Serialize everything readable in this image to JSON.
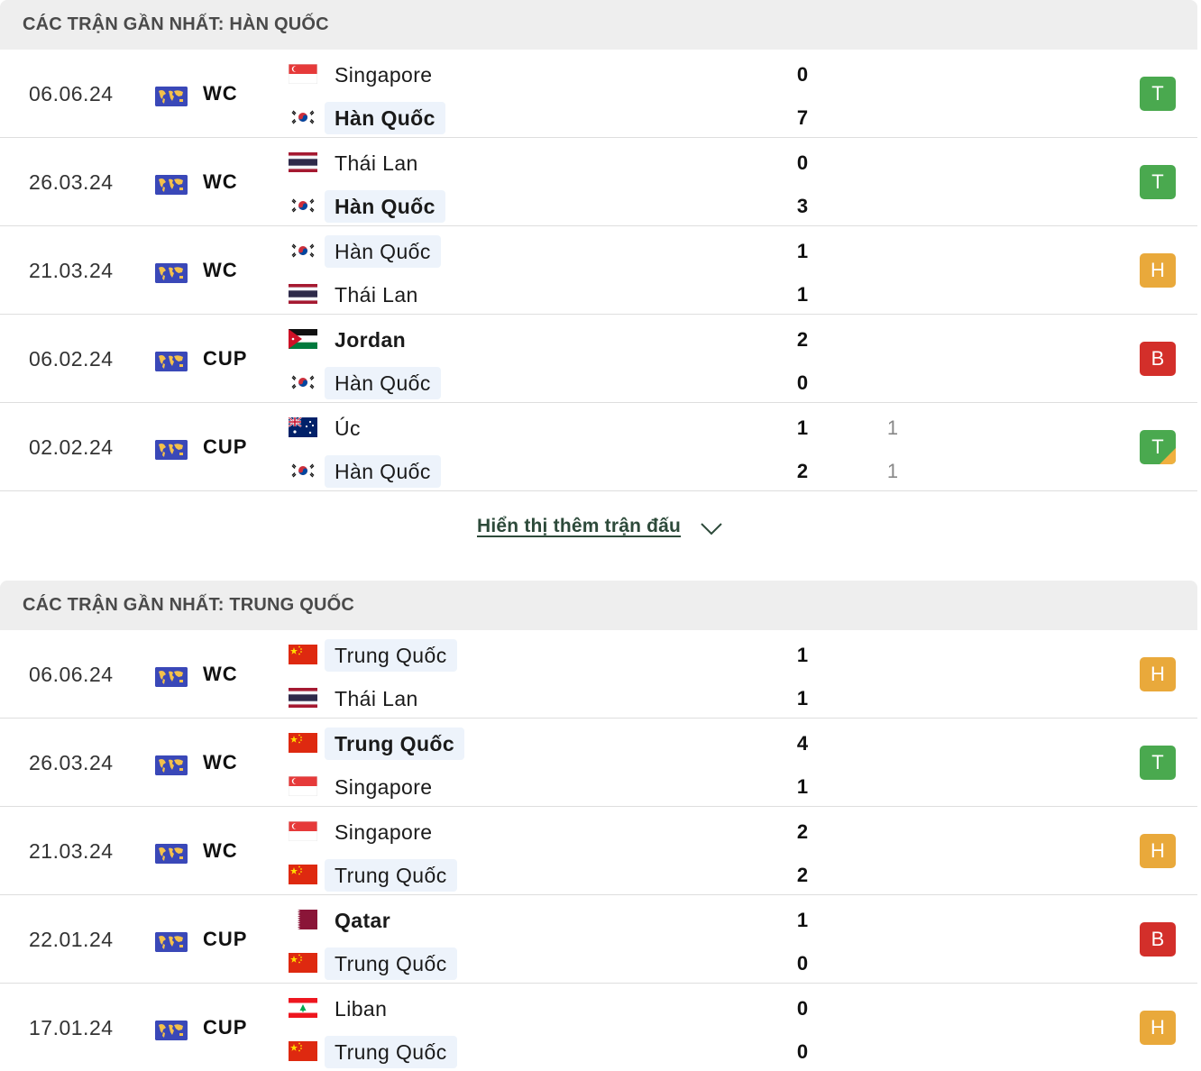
{
  "sections": [
    {
      "title": "CÁC TRẬN GẦN NHẤT: HÀN QUỐC",
      "matches": [
        {
          "date": "06.06.24",
          "comp": "WC",
          "home": {
            "name": "Singapore",
            "flag": "singapore-flag",
            "bold": false,
            "focus": false
          },
          "away": {
            "name": "Hàn Quốc",
            "flag": "korea-flag",
            "bold": true,
            "focus": true
          },
          "home_score": "0",
          "away_score": "7",
          "home_pen": "",
          "away_pen": "",
          "result": "T",
          "result_color": "#4aa94f"
        },
        {
          "date": "26.03.24",
          "comp": "WC",
          "home": {
            "name": "Thái Lan",
            "flag": "thailand-flag",
            "bold": false,
            "focus": false
          },
          "away": {
            "name": "Hàn Quốc",
            "flag": "korea-flag",
            "bold": true,
            "focus": true
          },
          "home_score": "0",
          "away_score": "3",
          "home_pen": "",
          "away_pen": "",
          "result": "T",
          "result_color": "#4aa94f"
        },
        {
          "date": "21.03.24",
          "comp": "WC",
          "home": {
            "name": "Hàn Quốc",
            "flag": "korea-flag",
            "bold": false,
            "focus": true
          },
          "away": {
            "name": "Thái Lan",
            "flag": "thailand-flag",
            "bold": false,
            "focus": false
          },
          "home_score": "1",
          "away_score": "1",
          "home_pen": "",
          "away_pen": "",
          "result": "H",
          "result_color": "#e9a93b"
        },
        {
          "date": "06.02.24",
          "comp": "CUP",
          "home": {
            "name": "Jordan",
            "flag": "jordan-flag",
            "bold": true,
            "focus": false
          },
          "away": {
            "name": "Hàn Quốc",
            "flag": "korea-flag",
            "bold": false,
            "focus": true
          },
          "home_score": "2",
          "away_score": "0",
          "home_pen": "",
          "away_pen": "",
          "result": "B",
          "result_color": "#d32f2a"
        },
        {
          "date": "02.02.24",
          "comp": "CUP",
          "home": {
            "name": "Úc",
            "flag": "australia-flag",
            "bold": false,
            "focus": false
          },
          "away": {
            "name": "Hàn Quốc",
            "flag": "korea-flag",
            "bold": false,
            "focus": true
          },
          "home_score": "1",
          "away_score": "2",
          "home_pen": "1",
          "away_pen": "1",
          "result": "T",
          "result_color": "#4aa94f",
          "result_corner": true
        }
      ]
    },
    {
      "title": "CÁC TRẬN GẦN NHẤT: TRUNG QUỐC",
      "matches": [
        {
          "date": "06.06.24",
          "comp": "WC",
          "home": {
            "name": "Trung Quốc",
            "flag": "china-flag",
            "bold": false,
            "focus": true
          },
          "away": {
            "name": "Thái Lan",
            "flag": "thailand-flag",
            "bold": false,
            "focus": false
          },
          "home_score": "1",
          "away_score": "1",
          "home_pen": "",
          "away_pen": "",
          "result": "H",
          "result_color": "#e9a93b"
        },
        {
          "date": "26.03.24",
          "comp": "WC",
          "home": {
            "name": "Trung Quốc",
            "flag": "china-flag",
            "bold": true,
            "focus": true
          },
          "away": {
            "name": "Singapore",
            "flag": "singapore-flag",
            "bold": false,
            "focus": false
          },
          "home_score": "4",
          "away_score": "1",
          "home_pen": "",
          "away_pen": "",
          "result": "T",
          "result_color": "#4aa94f"
        },
        {
          "date": "21.03.24",
          "comp": "WC",
          "home": {
            "name": "Singapore",
            "flag": "singapore-flag",
            "bold": false,
            "focus": false
          },
          "away": {
            "name": "Trung Quốc",
            "flag": "china-flag",
            "bold": false,
            "focus": true
          },
          "home_score": "2",
          "away_score": "2",
          "home_pen": "",
          "away_pen": "",
          "result": "H",
          "result_color": "#e9a93b"
        },
        {
          "date": "22.01.24",
          "comp": "CUP",
          "home": {
            "name": "Qatar",
            "flag": "qatar-flag",
            "bold": true,
            "focus": false
          },
          "away": {
            "name": "Trung Quốc",
            "flag": "china-flag",
            "bold": false,
            "focus": true
          },
          "home_score": "1",
          "away_score": "0",
          "home_pen": "",
          "away_pen": "",
          "result": "B",
          "result_color": "#d32f2a"
        },
        {
          "date": "17.01.24",
          "comp": "CUP",
          "home": {
            "name": "Liban",
            "flag": "lebanon-flag",
            "bold": false,
            "focus": false
          },
          "away": {
            "name": "Trung Quốc",
            "flag": "china-flag",
            "bold": false,
            "focus": true
          },
          "home_score": "0",
          "away_score": "0",
          "home_pen": "",
          "away_pen": "",
          "result": "H",
          "result_color": "#e9a93b"
        }
      ]
    }
  ],
  "show_more": {
    "label": "Hiển thị thêm trận đấu",
    "icon": "chevron-down-icon"
  },
  "competition_icon": "world-map-icon"
}
